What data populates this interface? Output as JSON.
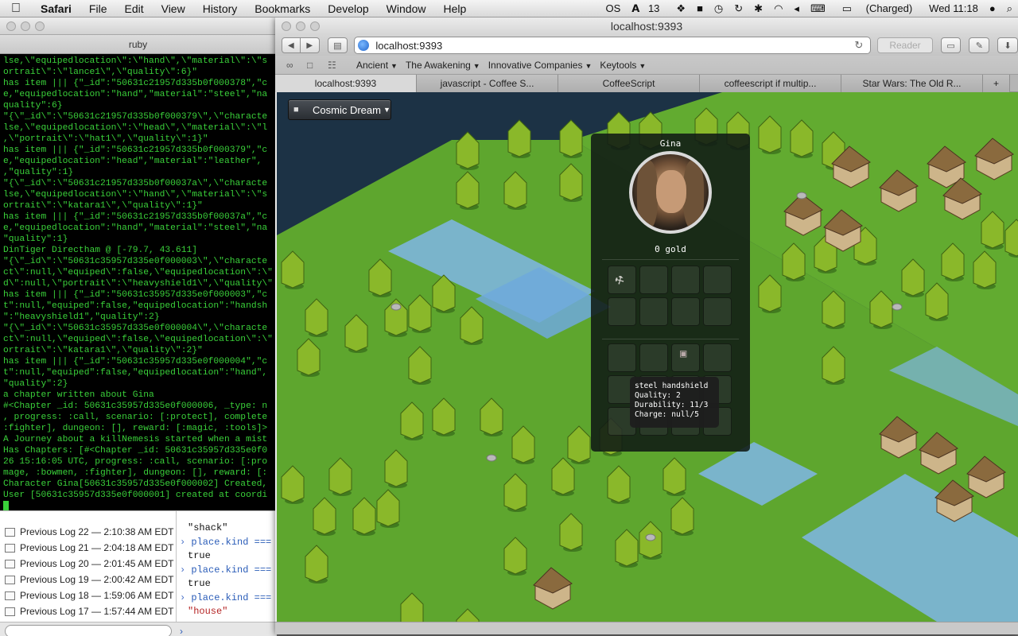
{
  "menubar": {
    "app": "Safari",
    "menus": [
      "File",
      "Edit",
      "View",
      "History",
      "Bookmarks",
      "Develop",
      "Window",
      "Help"
    ],
    "status": {
      "os_badge": "OS",
      "notifications": "13",
      "battery": "(Charged)",
      "clock": "Wed 11:18"
    }
  },
  "terminal_window": {
    "tab_title": "ruby",
    "lines": [
      "lse,\\\"equipedlocation\\\":\\\"hand\\\",\\\"material\\\":\\\"s",
      "ortrait\\\":\\\"lance1\\\",\\\"quality\\\":6}\"",
      "has item ||| {\"_id\":\"50631c21957d335b0f000378\",\"c",
      "e,\"equipedlocation\":\"hand\",\"material\":\"steel\",\"na",
      "quality\":6}",
      "\"{\\\"_id\\\":\\\"50631c21957d335b0f000379\\\",\\\"characte",
      "lse,\\\"equipedlocation\\\":\\\"head\\\",\\\"material\\\":\\\"l",
      ",\\\"portrait\\\":\\\"hat1\\\",\\\"quality\\\":1}\"",
      "has item ||| {\"_id\":\"50631c21957d335b0f000379\",\"c",
      "e,\"equipedlocation\":\"head\",\"material\":\"leather\",",
      ",\"quality\":1}",
      "\"{\\\"_id\\\":\\\"50631c21957d335b0f00037a\\\",\\\"characte",
      "lse,\\\"equipedlocation\\\":\\\"hand\\\",\\\"material\\\":\\\"s",
      "ortrait\\\":\\\"katara1\\\",\\\"quality\\\":1}\"",
      "has item ||| {\"_id\":\"50631c21957d335b0f00037a\",\"c",
      "e,\"equipedlocation\":\"hand\",\"material\":\"steel\",\"na",
      "\"quality\":1}",
      "DinTiger Directham @ [-79.7, 43.611]",
      "\"{\\\"_id\\\":\\\"50631c35957d335e0f000003\\\",\\\"characte",
      "ct\\\":null,\\\"equiped\\\":false,\\\"equipedlocation\\\":\\\"",
      "d\\\":null,\\\"portrait\\\":\\\"heavyshield1\\\",\\\"quality\\\"",
      "has item ||| {\"_id\":\"50631c35957d335e0f000003\",\"c",
      "t\":null,\"equiped\":false,\"equipedlocation\":\"handsh",
      "\":\"heavyshield1\",\"quality\":2}",
      "\"{\\\"_id\\\":\\\"50631c35957d335e0f000004\\\",\\\"characte",
      "ct\\\":null,\\\"equiped\\\":false,\\\"equipedlocation\\\":\\\"",
      "ortrait\\\":\\\"katara1\\\",\\\"quality\\\":2}\"",
      "has item ||| {\"_id\":\"50631c35957d335e0f000004\",\"c",
      "t\":null,\"equiped\":false,\"equipedlocation\":\"hand\",",
      "\"quality\":2}",
      "a chapter written about Gina",
      "#<Chapter _id: 50631c35957d335e0f000006, _type: n",
      ", progress: :call, scenario: [:protect], complete",
      ":fighter], dungeon: [], reward: [:magic, :tools]>",
      "A Journey about a killNemesis started when a mist",
      "Has Chapters: [#<Chapter _id: 50631c35957d335e0f0",
      "26 15:16:05 UTC, progress: :call, scenario: [:pro",
      "mage, :bowmen, :fighter], dungeon: [], reward: [:",
      "Character Gina[50631c35957d335e0f000002] Created,",
      "User [50631c35957d335e0f000001] created at coordi"
    ]
  },
  "console": {
    "logs": [
      {
        "name": "Previous Log 22",
        "time": "2:10:38 AM EDT"
      },
      {
        "name": "Previous Log 21",
        "time": "2:04:18 AM EDT"
      },
      {
        "name": "Previous Log 20",
        "time": "2:01:45 AM EDT"
      },
      {
        "name": "Previous Log 19",
        "time": "2:00:42 AM EDT"
      },
      {
        "name": "Previous Log 18",
        "time": "1:59:06 AM EDT"
      },
      {
        "name": "Previous Log 17",
        "time": "1:57:44 AM EDT"
      }
    ],
    "output": [
      {
        "kind": "res",
        "text": "\"shack\""
      },
      {
        "kind": "cmd",
        "text": "place.kind ==="
      },
      {
        "kind": "res",
        "text": "true"
      },
      {
        "kind": "cmd",
        "text": "place.kind ==="
      },
      {
        "kind": "res",
        "text": "true"
      },
      {
        "kind": "cmd",
        "text": "place.kind ==="
      },
      {
        "kind": "res-str",
        "text": "\"house\""
      }
    ],
    "prompt": "›"
  },
  "safari": {
    "window_title": "localhost:9393",
    "url": "localhost:9393",
    "reader_label": "Reader",
    "bookmarks": [
      "Ancient",
      "The Awakening",
      "Innovative Companies",
      "Keytools"
    ],
    "tabs": [
      "localhost:9393",
      "javascript - Coffee S...",
      "CoffeeScript",
      "coffeescript if multip...",
      "Star Wars: The Old R..."
    ],
    "active_tab": 0
  },
  "game": {
    "world_button": "Cosmic Dream",
    "character": {
      "name": "Gina",
      "gold": "0 gold"
    },
    "tooltip": {
      "item": "steel handshield",
      "quality": "Quality: 2",
      "durability": "Durability: 11/3",
      "charge": "Charge: null/5"
    }
  },
  "colors": {
    "terminal_text": "#3ad13a",
    "grass": "#5ea62e",
    "water": "#7fb6e6",
    "tree": "#8ab82a",
    "panel_bg": "#101a14"
  }
}
